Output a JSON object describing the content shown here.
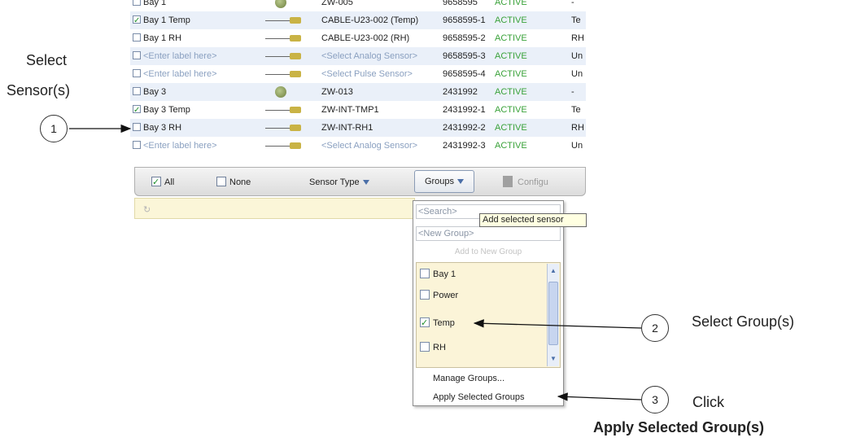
{
  "table": {
    "rows": [
      {
        "label": "Bay 1",
        "checked": false,
        "icon": "logger-icon",
        "device": "ZW-005",
        "serial": "9658595",
        "status": "ACTIVE",
        "extra": "-"
      },
      {
        "label": "Bay 1 Temp",
        "checked": true,
        "icon": "cable-sensor-icon",
        "device": "CABLE-U23-002 (Temp)",
        "serial": "9658595-1",
        "status": "ACTIVE",
        "extra": "Te"
      },
      {
        "label": "Bay 1 RH",
        "checked": false,
        "icon": "cable-sensor-icon",
        "device": "CABLE-U23-002 (RH)",
        "serial": "9658595-2",
        "status": "ACTIVE",
        "extra": "RH"
      },
      {
        "label": "<Enter label here>",
        "checked": false,
        "icon": "cable-sensor-icon",
        "device": "<Select Analog Sensor>",
        "serial": "9658595-3",
        "status": "ACTIVE",
        "extra": "Un"
      },
      {
        "label": "<Enter label here>",
        "checked": false,
        "icon": "cable-sensor-icon",
        "device": "<Select Pulse Sensor>",
        "serial": "9658595-4",
        "status": "ACTIVE",
        "extra": "Un"
      },
      {
        "label": "Bay 3",
        "checked": false,
        "icon": "logger-icon",
        "device": "ZW-013",
        "serial": "2431992",
        "status": "ACTIVE",
        "extra": "-"
      },
      {
        "label": "Bay 3 Temp",
        "checked": true,
        "icon": "cable-sensor-icon",
        "device": "ZW-INT-TMP1",
        "serial": "2431992-1",
        "status": "ACTIVE",
        "extra": "Te"
      },
      {
        "label": "Bay 3 RH",
        "checked": false,
        "icon": "cable-sensor-icon",
        "device": "ZW-INT-RH1",
        "serial": "2431992-2",
        "status": "ACTIVE",
        "extra": "RH"
      },
      {
        "label": "<Enter label here>",
        "checked": false,
        "icon": "cable-sensor-icon",
        "device": "<Select Analog Sensor>",
        "serial": "2431992-3",
        "status": "ACTIVE",
        "extra": "Un"
      }
    ]
  },
  "toolbar": {
    "all_label": "All",
    "none_label": "None",
    "sensor_type_label": "Sensor Type",
    "groups_label": "Groups",
    "configure_label": "Configu"
  },
  "dropdown": {
    "search_placeholder": "<Search>",
    "new_group_placeholder": "<New Group>",
    "add_to_new_group": "Add to New Group",
    "groups": [
      {
        "name": "Bay 1",
        "checked": false
      },
      {
        "name": "Power",
        "checked": false
      },
      {
        "name": "Temp",
        "checked": true
      },
      {
        "name": "RH",
        "checked": false
      }
    ],
    "manage_groups": "Manage Groups...",
    "apply_selected_groups": "Apply Selected Groups"
  },
  "tooltip": {
    "text": "Add selected sensor"
  },
  "annotations": {
    "select_sensors_line1": "Select",
    "select_sensors_line2": "Sensor(s)",
    "step1": "1",
    "step2": "2",
    "step2_text": "Select Group(s)",
    "step3": "3",
    "step3_text": "Click",
    "step3_bold": "Apply Selected Group(s)"
  },
  "colors": {
    "active_status": "#3aa23a",
    "row_alt": "#eaf0f9",
    "dropdown_list_bg": "#fbf4d8",
    "tooltip_bg": "#ffffe1"
  }
}
